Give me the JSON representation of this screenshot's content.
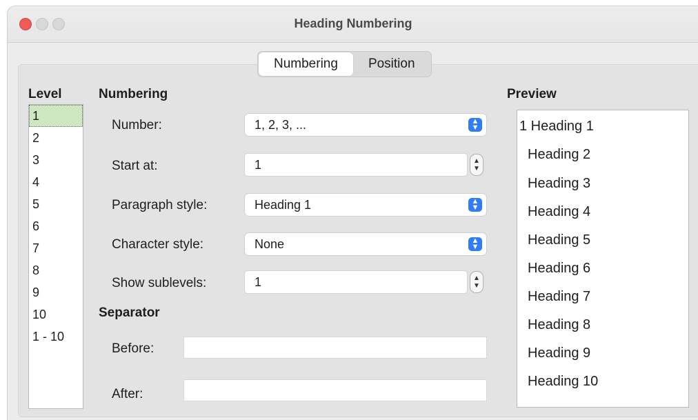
{
  "window": {
    "title": "Heading Numbering"
  },
  "tabs": [
    {
      "label": "Numbering",
      "active": true
    },
    {
      "label": "Position",
      "active": false
    }
  ],
  "level": {
    "heading": "Level",
    "items": [
      "1",
      "2",
      "3",
      "4",
      "5",
      "6",
      "7",
      "8",
      "9",
      "10",
      "1 - 10"
    ],
    "selected": "1"
  },
  "numbering": {
    "heading": "Numbering",
    "number_label": "Number:",
    "number_value": "1, 2, 3, ...",
    "start_label": "Start at:",
    "start_value": "1",
    "para_label": "Paragraph style:",
    "para_value": "Heading 1",
    "char_label": "Character style:",
    "char_value": "None",
    "sublevels_label": "Show sublevels:",
    "sublevels_value": "1"
  },
  "separator": {
    "heading": "Separator",
    "before_label": "Before:",
    "before_value": "",
    "after_label": "After:",
    "after_value": ""
  },
  "preview": {
    "heading": "Preview",
    "items": [
      "1 Heading 1",
      "Heading 2",
      "Heading 3",
      "Heading 4",
      "Heading 5",
      "Heading 6",
      "Heading 7",
      "Heading 8",
      "Heading 9",
      "Heading 10"
    ]
  },
  "colors": {
    "accent": "#2f7cf6",
    "selected_row": "#cfe8c2",
    "close": "#ee5b58"
  }
}
